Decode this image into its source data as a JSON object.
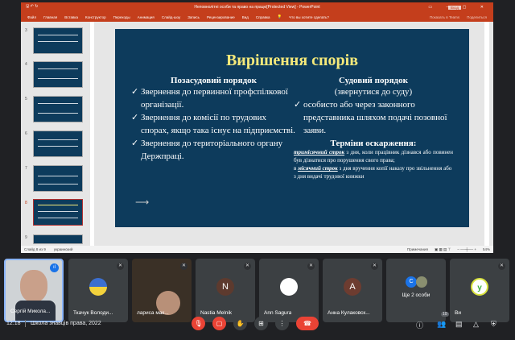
{
  "powerpoint": {
    "title": "Неповнолітні особи та право на працю[Protected View] - PowerPoint",
    "login": "Вход",
    "menu": [
      "Файл",
      "Главная",
      "Вставка",
      "Конструктор",
      "Переходы",
      "Анимация",
      "Слайд-шоу",
      "Запись",
      "Рецензирование",
      "Вид",
      "Справка"
    ],
    "tell_me": "Что вы хотите сделать?",
    "teams": "Показать в Teams",
    "share": "Поделиться",
    "slide_numbers": [
      "3",
      "4",
      "5",
      "6",
      "7",
      "8",
      "9"
    ],
    "selected_slide": "8",
    "status": {
      "slide": "Слайд 8 из 9",
      "language": "украинский",
      "notes": "Примечания",
      "zoom": "54%"
    }
  },
  "slide": {
    "title": "Вирішення спорів",
    "left_heading": "Позасудовий порядок",
    "left_items": [
      "Звернення до первинної профспілкової організації.",
      "Звернення до комісії по трудових спорах, якщо така існує на підприємстві.",
      "Звернення до територіального органу Держпраці."
    ],
    "right_heading": "Судовий порядок",
    "right_sub": "(звернутися до суду)",
    "right_items": [
      "особисто або через законного представника шляхом подачі позовної заяви."
    ],
    "terms_heading": "Терміни оскарження:",
    "term1_em": "тримісячний строк",
    "term1_text": " з дня, коли працівник дізнався або повинен був дізнатися про порушення свого права;",
    "term2_pre": "в ",
    "term2_em": "місячний строк",
    "term2_text": "  з дня вручення копії наказу про звільнення або з дня видачі трудової книжки",
    "arrow": "⟶"
  },
  "participants": [
    {
      "name": "Сергій Микола...",
      "speaking": true
    },
    {
      "name": "Ткачук Володи..."
    },
    {
      "name": "лариса мак..."
    },
    {
      "name": "Nastia Melnik",
      "initial": "N",
      "color": "#5d3a2e"
    },
    {
      "name": "Ann Sagura",
      "initial": "",
      "color": "#ffffff"
    },
    {
      "name": "Анна Кулаковск...",
      "initial": "А",
      "color": "#6d3c30"
    },
    {
      "name": "Ще 2 особи",
      "initial": "C",
      "color": "#1a73e8"
    },
    {
      "name": "Ви"
    }
  ],
  "meeting": {
    "time": "12:18",
    "title": "Школа знавців права, 2022",
    "people_count": "10"
  }
}
